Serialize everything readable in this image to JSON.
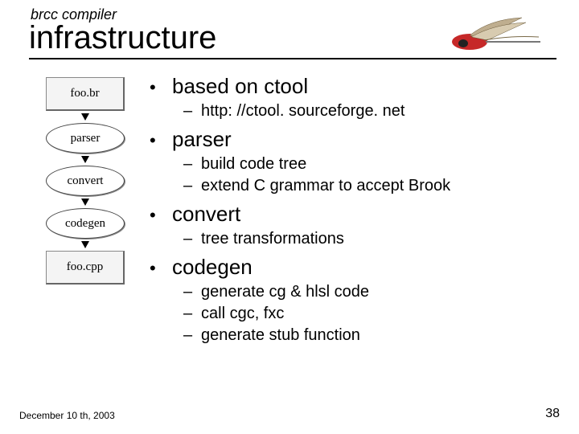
{
  "header": {
    "subtitle": "brcc compiler",
    "title": "infrastructure"
  },
  "diagram": {
    "nodes": [
      {
        "shape": "box",
        "label": "foo.br"
      },
      {
        "shape": "oval",
        "label": "parser"
      },
      {
        "shape": "oval",
        "label": "convert"
      },
      {
        "shape": "oval",
        "label": "codegen"
      },
      {
        "shape": "box",
        "label": "foo.cpp"
      }
    ]
  },
  "bullets": [
    {
      "label": "based on ctool",
      "subs": [
        "http: //ctool. sourceforge. net"
      ]
    },
    {
      "label": "parser",
      "subs": [
        "build code tree",
        "extend C grammar to accept Brook"
      ]
    },
    {
      "label": "convert",
      "subs": [
        "tree transformations"
      ]
    },
    {
      "label": "codegen",
      "subs": [
        "generate cg & hlsl code",
        "call cgc, fxc",
        "generate stub function"
      ]
    }
  ],
  "footer": {
    "date": "December 10 th, 2003",
    "page": "38"
  },
  "glyphs": {
    "bullet": "•",
    "dash": "–"
  }
}
